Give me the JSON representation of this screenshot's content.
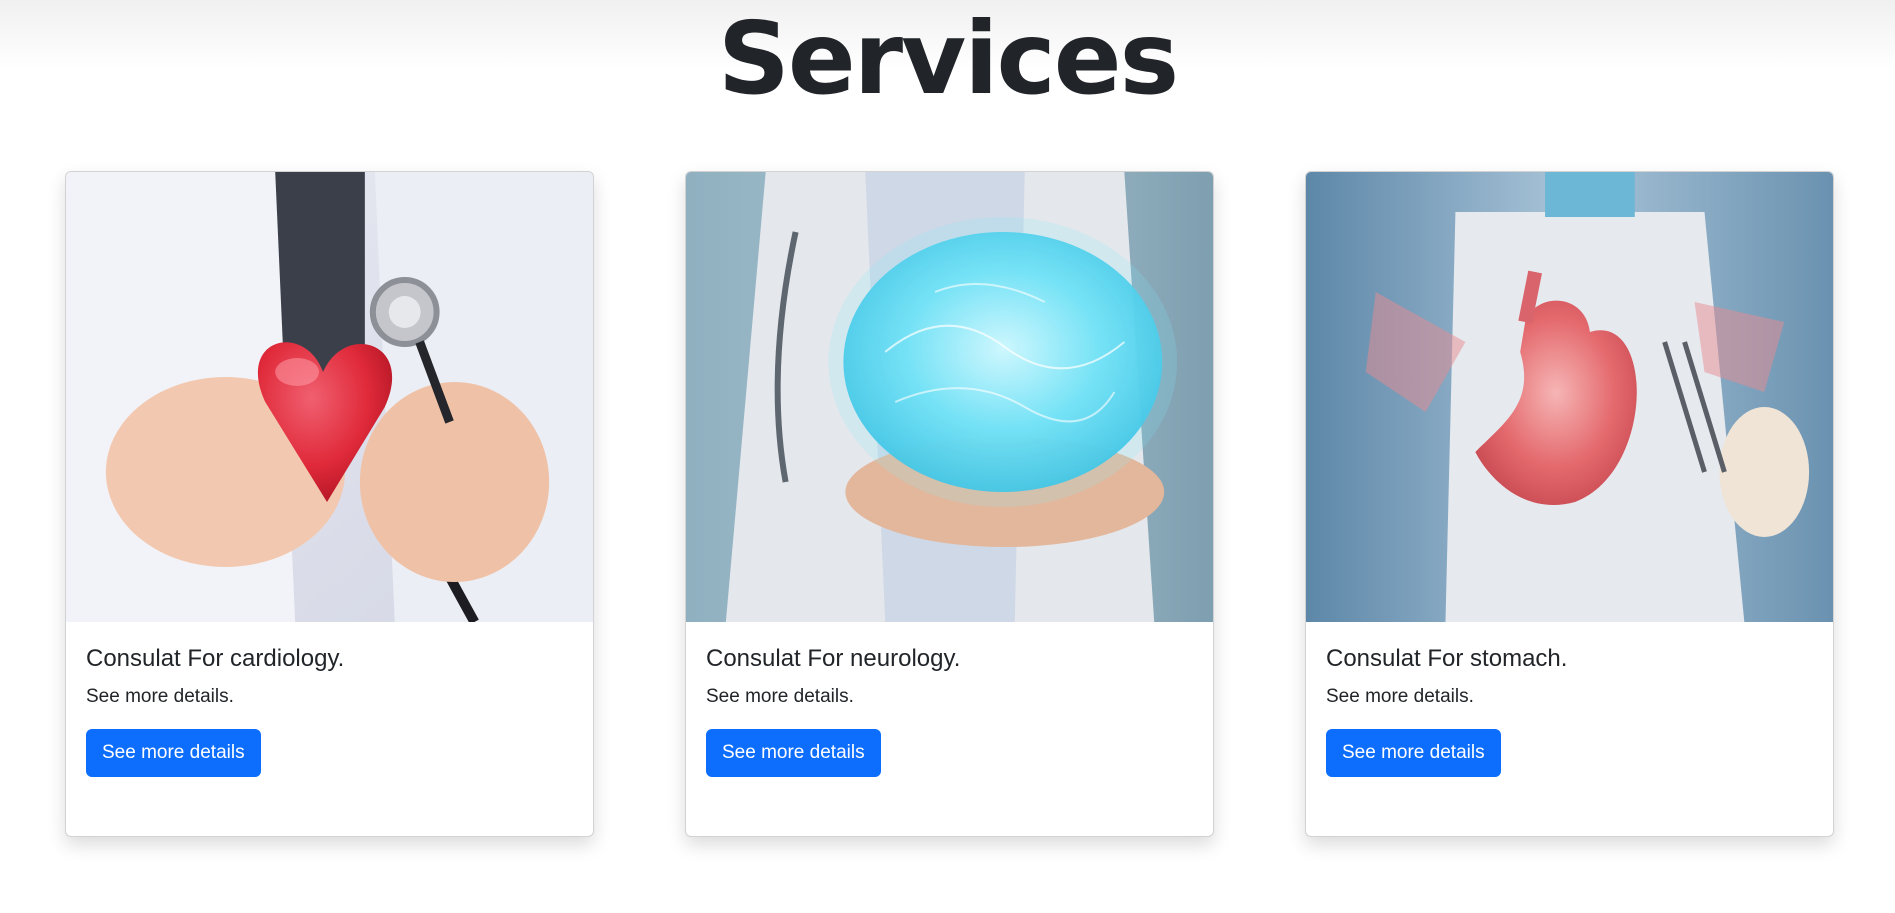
{
  "page": {
    "title": "Services"
  },
  "theme": {
    "button_color": "#0d6efd",
    "text_color": "#212529"
  },
  "cards": [
    {
      "image_subject": "heart-stethoscope-image",
      "title": "Consulat For cardiology.",
      "text": "See more details.",
      "button_label": "See more details"
    },
    {
      "image_subject": "glowing-brain-image",
      "title": "Consulat For neurology.",
      "text": "See more details.",
      "button_label": "See more details"
    },
    {
      "image_subject": "stomach-hologram-image",
      "title": "Consulat For stomach.",
      "text": "See more details.",
      "button_label": "See more details"
    }
  ]
}
